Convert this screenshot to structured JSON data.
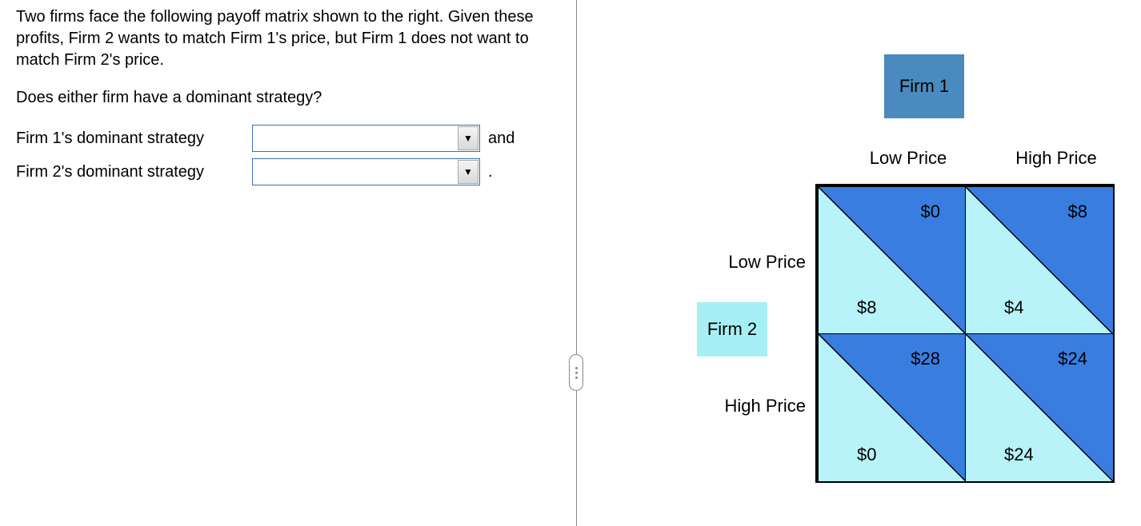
{
  "question": {
    "para1": "Two firms face the following payoff matrix shown to the right.  Given these profits, Firm 2 wants to match Firm 1's price, but Firm 1 does not want to match Firm 2's price.",
    "para2": "Does either firm have a dominant strategy?",
    "row1_label": "Firm 1's dominant strategy",
    "row1_after": "and",
    "row2_label": "Firm 2's dominant strategy",
    "row2_after": "."
  },
  "matrix": {
    "firm1_label": "Firm 1",
    "firm2_label": "Firm 2",
    "col_headers": [
      "Low Price",
      "High Price"
    ],
    "row_headers": [
      "Low Price",
      "High Price"
    ],
    "colors": {
      "firm1_fill": "#3a7de0",
      "firm2_fill": "#b7f3f8"
    },
    "cells": {
      "tl": {
        "firm1": "$0",
        "firm2": "$8"
      },
      "tr": {
        "firm1": "$8",
        "firm2": "$4"
      },
      "bl": {
        "firm1": "$28",
        "firm2": "$0"
      },
      "br": {
        "firm1": "$24",
        "firm2": "$24"
      }
    }
  },
  "chart_data": {
    "type": "table",
    "description": "2x2 payoff matrix; upper-right triangle = Firm 1 payoff, lower-left triangle = Firm 2 payoff",
    "players": {
      "columns": "Firm 1",
      "rows": "Firm 2"
    },
    "col_strategies": [
      "Low Price",
      "High Price"
    ],
    "row_strategies": [
      "Low Price",
      "High Price"
    ],
    "payoffs": [
      {
        "firm2_row": "Low Price",
        "firm1_col": "Low Price",
        "firm1_payoff": 0,
        "firm2_payoff": 8
      },
      {
        "firm2_row": "Low Price",
        "firm1_col": "High Price",
        "firm1_payoff": 8,
        "firm2_payoff": 4
      },
      {
        "firm2_row": "High Price",
        "firm1_col": "Low Price",
        "firm1_payoff": 28,
        "firm2_payoff": 0
      },
      {
        "firm2_row": "High Price",
        "firm1_col": "High Price",
        "firm1_payoff": 24,
        "firm2_payoff": 24
      }
    ]
  }
}
